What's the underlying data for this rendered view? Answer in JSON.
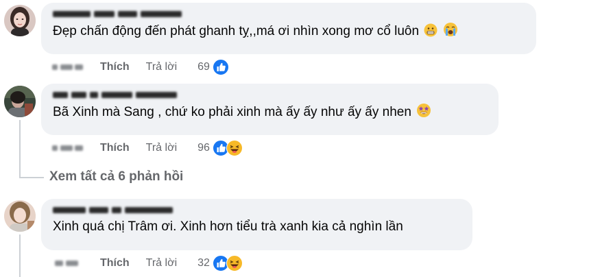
{
  "comments": [
    {
      "author": "Nguyễn Thị Thu Hương",
      "text": "Đẹp chấn động đến phát ghanh tỵ,,má ơi nhìn xong mơ cổ luôn",
      "like_label": "Thích",
      "reply_label": "Trả lời",
      "reaction_count": "69",
      "emojis": [
        "grimacing-face-icon",
        "crying-face-icon"
      ]
    },
    {
      "author": "Lê Thị Thùy Dương",
      "text": "Bã Xinh mà Sang , chứ ko phải xinh mà ấy ấy như ấy ấy nhen",
      "like_label": "Thích",
      "reply_label": "Trả lời",
      "reaction_count": "96",
      "emojis": [
        "star-struck-face-icon"
      ]
    },
    {
      "author": "Hoàng Minh Nguyễn",
      "text": "Xinh quá chị Trâm ơi. Xinh hơn tiểu trà xanh kia cả nghìn lần",
      "like_label": "Thích",
      "reply_label": "Trả lời",
      "reaction_count": "32",
      "emojis": []
    }
  ],
  "view_replies": "Xem tất cả 6 phản hồi",
  "colors": {
    "bubble": "#f0f2f5",
    "meta_text": "#65676b",
    "like_blue": "#1877f2",
    "haha_yellow": "#f7b928"
  }
}
